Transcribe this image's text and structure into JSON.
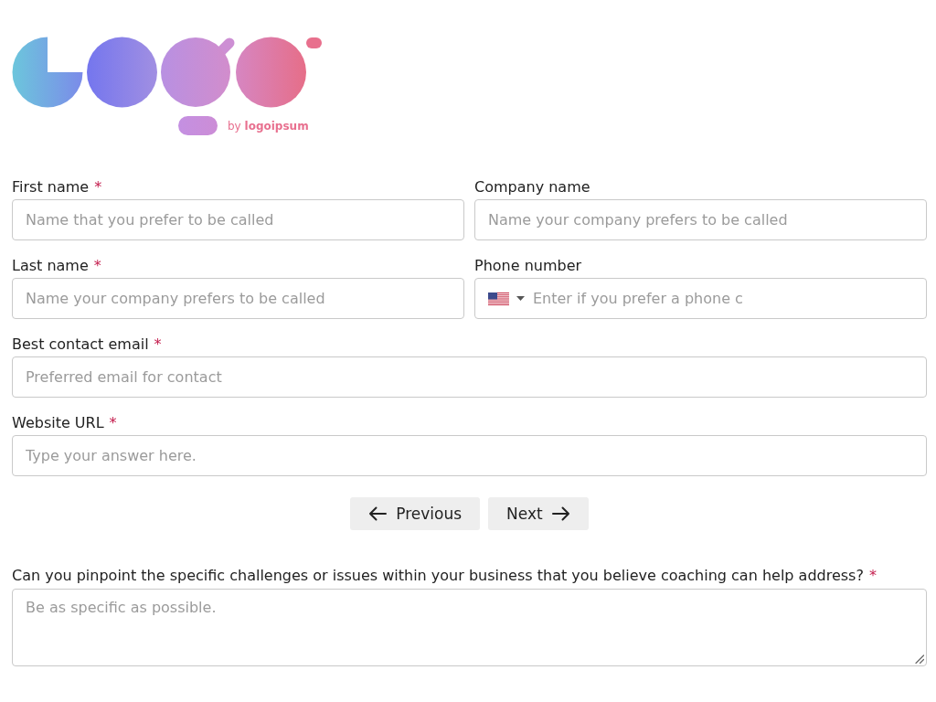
{
  "logo": {
    "byline": "by **logoipsum**"
  },
  "rows": [
    {
      "fields": [
        {
          "kind": "text",
          "label": "First name",
          "required_mark": "*",
          "placeholder": "Name that you prefer to be called"
        },
        {
          "kind": "text",
          "label": "Company name",
          "placeholder": "Name your company prefers to be called"
        }
      ]
    },
    {
      "fields": [
        {
          "kind": "text",
          "label": "Last name",
          "required_mark": "*",
          "placeholder": "Name your company prefers to be called"
        },
        {
          "kind": "phone",
          "label": "Phone number",
          "placeholder": "Enter if you prefer a phone c"
        }
      ]
    },
    {
      "fields": [
        {
          "kind": "text",
          "label": "Best contact email",
          "required_mark": "*",
          "placeholder": "Preferred email for contact"
        }
      ]
    },
    {
      "fields": [
        {
          "kind": "text",
          "label": "Website URL",
          "required_mark": "*",
          "placeholder": "Type your answer here."
        }
      ]
    }
  ],
  "nav_buttons": [
    {
      "kind": "back",
      "label": "Previous"
    },
    {
      "kind": "forward",
      "label": "Next"
    }
  ],
  "question": {
    "label": "Can you pinpoint the specific challenges or issues within your business that you believe coaching can help address?",
    "required_mark": "*",
    "placeholder": "Be as specific as possible."
  }
}
